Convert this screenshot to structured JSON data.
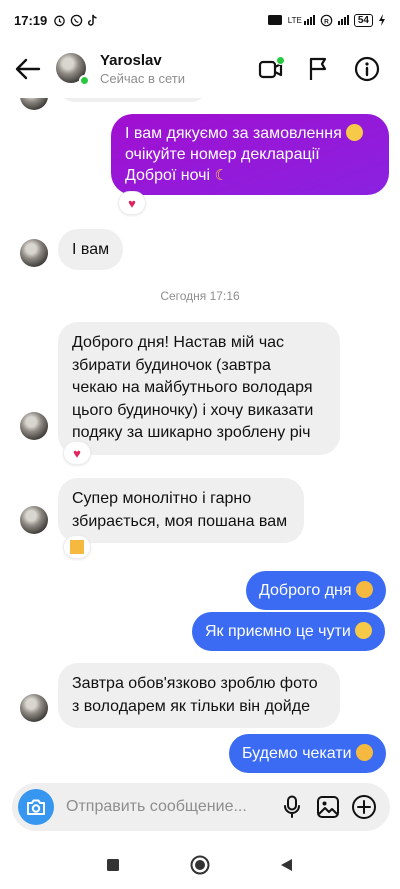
{
  "status_bar": {
    "time": "17:19",
    "lte_label": "LTE",
    "battery_level": "54"
  },
  "header": {
    "contact_name": "Yaroslav",
    "contact_status": "Сейчас в сети"
  },
  "messages": [
    {
      "id": "m1",
      "direction": "out",
      "lines": [
        "І вам дякуємо за замовлення",
        "очікуйте номер декларації",
        "Доброї ночі"
      ],
      "emojis": [
        "hugging-face-emoji",
        "crescent-moon-emoji"
      ],
      "reaction": "heart"
    },
    {
      "id": "m2",
      "direction": "in",
      "text": "І вам"
    },
    {
      "id": "m3",
      "direction": "in",
      "lines": [
        "Доброго дня! Настав мій час",
        "збирати будиночок (завтра",
        "чекаю на майбутнього володаря",
        "цього будиночку) і хочу виказати",
        "подяку за шикарно зроблену річ"
      ],
      "reaction": "heart"
    },
    {
      "id": "m4",
      "direction": "in",
      "lines": [
        "Супер монолітно і гарно",
        "збирається, моя пошана вам"
      ],
      "reaction": "cat-face"
    },
    {
      "id": "m5",
      "direction": "out",
      "text": "Доброго дня",
      "emojis": [
        "smiling-cat-emoji"
      ]
    },
    {
      "id": "m6",
      "direction": "out",
      "text": "Як приємно це чути",
      "emojis": [
        "smiling-face-emoji"
      ]
    },
    {
      "id": "m7",
      "direction": "in",
      "lines": [
        "Завтра обов'язково зроблю фото",
        "з володарем як тільки він дойде"
      ]
    },
    {
      "id": "m8",
      "direction": "out",
      "text": "Будемо чекати",
      "emojis": [
        "smiling-cat-emoji"
      ]
    }
  ],
  "timestamp_divider": "Сегодня 17:16",
  "composer": {
    "placeholder": "Отправить сообщение..."
  },
  "colors": {
    "purple_bubble": "#9b17d6",
    "blue_bubble": "#3a6bf2",
    "incoming_bubble": "#efefef",
    "online": "#28c840",
    "camera_button": "#3797f0"
  }
}
